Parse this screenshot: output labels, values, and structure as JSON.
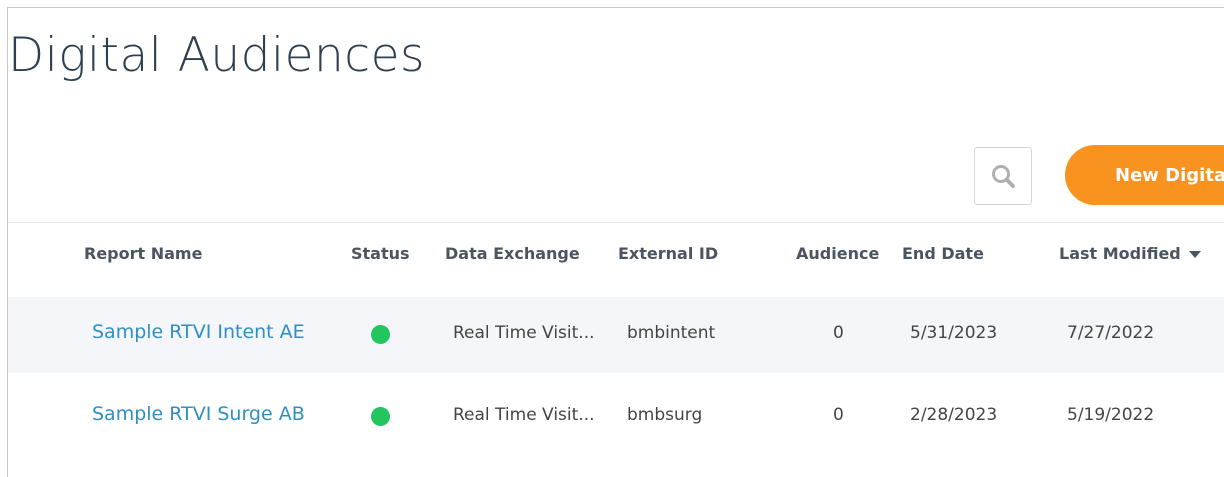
{
  "page": {
    "title": "Digital Audiences",
    "new_button_label": "New Digita"
  },
  "table": {
    "columns": [
      "Report Name",
      "Status",
      "Data Exchange",
      "External ID",
      "Audience",
      "End Date",
      "Last Modified"
    ],
    "sort_column": "Last Modified",
    "sort_direction": "descending",
    "rows": [
      {
        "report_name": "Sample RTVI Intent AE",
        "status": "active",
        "status_color": "#22c55e",
        "data_exchange": "Real Time Visit...",
        "external_id": "bmbintent",
        "audience": "0",
        "end_date": "5/31/2023",
        "last_modified": "7/27/2022"
      },
      {
        "report_name": "Sample RTVI Surge AB",
        "status": "active",
        "status_color": "#22c55e",
        "data_exchange": "Real Time Visit...",
        "external_id": "bmbsurg",
        "audience": "0",
        "end_date": "2/28/2023",
        "last_modified": "5/19/2022"
      }
    ]
  },
  "icons": {
    "search": "search-icon",
    "sort": "caret-down-icon",
    "status": "status-dot-icon"
  },
  "colors": {
    "accent": "#f7931e",
    "link": "#2f8fc5",
    "status_active": "#22c55e",
    "row_alt": "#f4f6fa"
  }
}
